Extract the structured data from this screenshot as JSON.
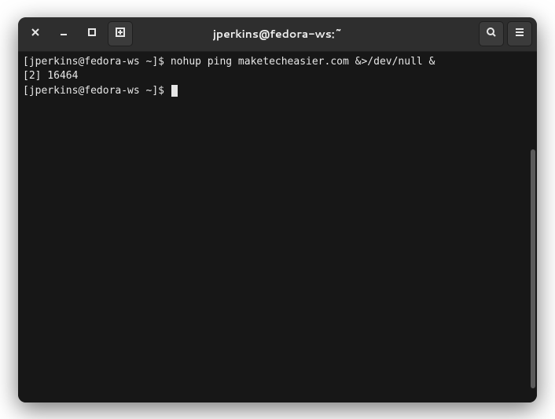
{
  "window": {
    "title": "jperkins@fedora-ws:~"
  },
  "terminal": {
    "lines": [
      "[jperkins@fedora-ws ~]$ nohup ping maketecheasier.com &>/dev/null &",
      "[2] 16464",
      "[jperkins@fedora-ws ~]$ "
    ]
  },
  "scrollbar": {
    "thumb_top_pct": 28,
    "thumb_height_pct": 68
  }
}
